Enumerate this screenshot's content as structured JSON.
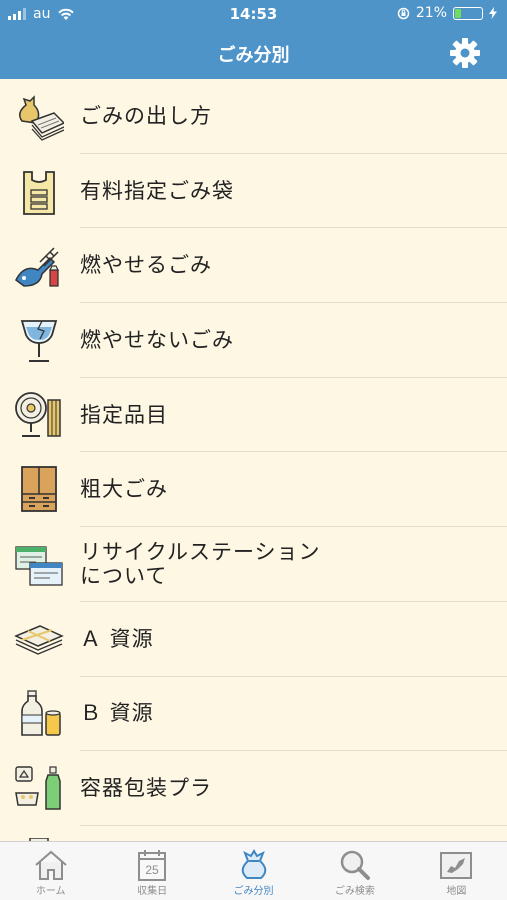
{
  "status": {
    "carrier": "au",
    "time": "14:53",
    "battery": "21%",
    "battery_level": 0.21
  },
  "header": {
    "title": "ごみ分別"
  },
  "items": [
    {
      "label": "ごみの出し方",
      "icon": "garbage-bag-newspaper-icon"
    },
    {
      "label": "有料指定ごみ袋",
      "icon": "designated-bag-icon"
    },
    {
      "label": "燃やせるごみ",
      "icon": "burnable-garbage-icon"
    },
    {
      "label": "燃やせないごみ",
      "icon": "broken-glass-icon"
    },
    {
      "label": "指定品目",
      "icon": "fan-futon-icon"
    },
    {
      "label": "粗大ごみ",
      "icon": "cabinet-icon"
    },
    {
      "label": "リサイクルステーション\nについて",
      "icon": "recycle-station-icon"
    },
    {
      "label": "Ａ 資源",
      "icon": "newspaper-bundle-icon"
    },
    {
      "label": "Ｂ 資源",
      "icon": "bottle-can-icon"
    },
    {
      "label": "容器包装プラ",
      "icon": "plastic-container-icon"
    }
  ],
  "tabs": [
    {
      "label": "ホーム",
      "icon": "home-icon",
      "active": false
    },
    {
      "label": "収集日",
      "icon": "calendar-icon",
      "calendar_day": "25",
      "active": false
    },
    {
      "label": "ごみ分別",
      "icon": "garbage-bag-icon",
      "active": true
    },
    {
      "label": "ごみ検索",
      "icon": "magnifier-icon",
      "active": false
    },
    {
      "label": "地図",
      "icon": "map-icon",
      "active": false
    }
  ],
  "colors": {
    "accent": "#4e94c9",
    "background": "#fdf7e4",
    "active_tab": "#3f86c2",
    "inactive_tab": "#8e8e8e"
  }
}
